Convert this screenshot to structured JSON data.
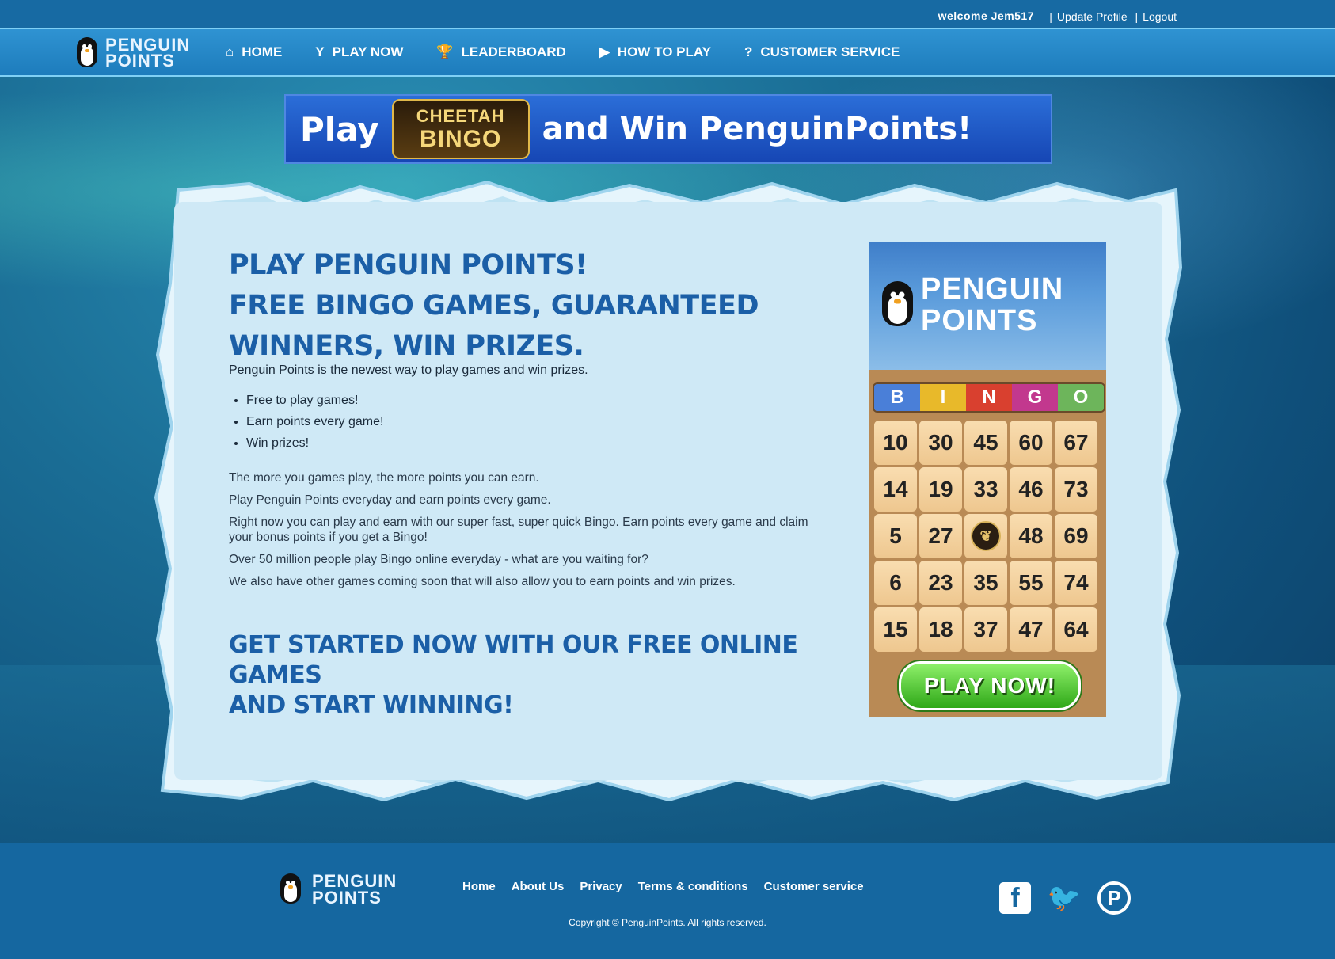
{
  "top": {
    "welcome": "welcome Jem517",
    "links": [
      "Update Profile",
      "Logout"
    ]
  },
  "brand": {
    "line1": "PENGUIN",
    "line2": "POINTS"
  },
  "nav": [
    {
      "label": "HOME",
      "icon": "home-icon",
      "glyph": "⌂"
    },
    {
      "label": "PLAY NOW",
      "icon": "cocktail-glass-icon",
      "glyph": "Y"
    },
    {
      "label": "LEADERBOARD",
      "icon": "trophy-icon",
      "glyph": "🏆"
    },
    {
      "label": "HOW TO PLAY",
      "icon": "play-circle-icon",
      "glyph": "▶"
    },
    {
      "label": "CUSTOMER SERVICE",
      "icon": "question-circle-icon",
      "glyph": "?"
    }
  ],
  "banner": {
    "play": "Play",
    "logo_top": "CHEETAH",
    "logo_bottom": "BINGO",
    "rest": "and Win PenguinPoints!"
  },
  "main": {
    "heading_lines": [
      "Play Penguin Points!",
      "Free Bingo Games, Guaranteed",
      "Winners, Win Prizes."
    ],
    "intro": "Penguin Points is the newest way to play games and win prizes.",
    "bullets": [
      "Free to play games!",
      "Earn points every game!",
      "Win prizes!"
    ],
    "paragraphs": [
      "The more you games play, the more points you can earn.",
      "Play Penguin Points everyday and earn points every game.",
      "Right now you can play and earn with our super fast, super quick Bingo. Earn points every game and claim your bonus points if you get a Bingo!",
      "Over 50 million people play Bingo online everyday - what are you waiting for?",
      "We also have other games coming soon that will also allow you to earn points and win prizes."
    ],
    "cta_lines": [
      "Get started now with our free online games",
      "and start winning!"
    ]
  },
  "card": {
    "logo1": "PENGUIN",
    "logo2": "POINTS",
    "letters": [
      {
        "l": "B",
        "color": "#4a7fd8"
      },
      {
        "l": "I",
        "color": "#e8b92a"
      },
      {
        "l": "N",
        "color": "#d9402f"
      },
      {
        "l": "G",
        "color": "#c2388e"
      },
      {
        "l": "O",
        "color": "#6db55b"
      }
    ],
    "numbers": [
      [
        "10",
        "30",
        "45",
        "60",
        "67"
      ],
      [
        "14",
        "19",
        "33",
        "46",
        "73"
      ],
      [
        "5",
        "27",
        "FREE",
        "48",
        "69"
      ],
      [
        "6",
        "23",
        "35",
        "55",
        "74"
      ],
      [
        "15",
        "18",
        "37",
        "47",
        "64"
      ]
    ],
    "play_button": "PLAY NOW!"
  },
  "footer": {
    "logo1": "PENGUIN",
    "logo2": "POINTS",
    "links": [
      "Home",
      "About Us",
      "Privacy",
      "Terms & conditions",
      "Customer service"
    ],
    "copyright": "Copyright © PenguinPoints. All rights reserved.",
    "social": [
      {
        "name": "facebook-icon",
        "glyph": "f"
      },
      {
        "name": "twitter-icon",
        "glyph": "🐦"
      },
      {
        "name": "pinterest-icon",
        "glyph": "P"
      }
    ]
  }
}
